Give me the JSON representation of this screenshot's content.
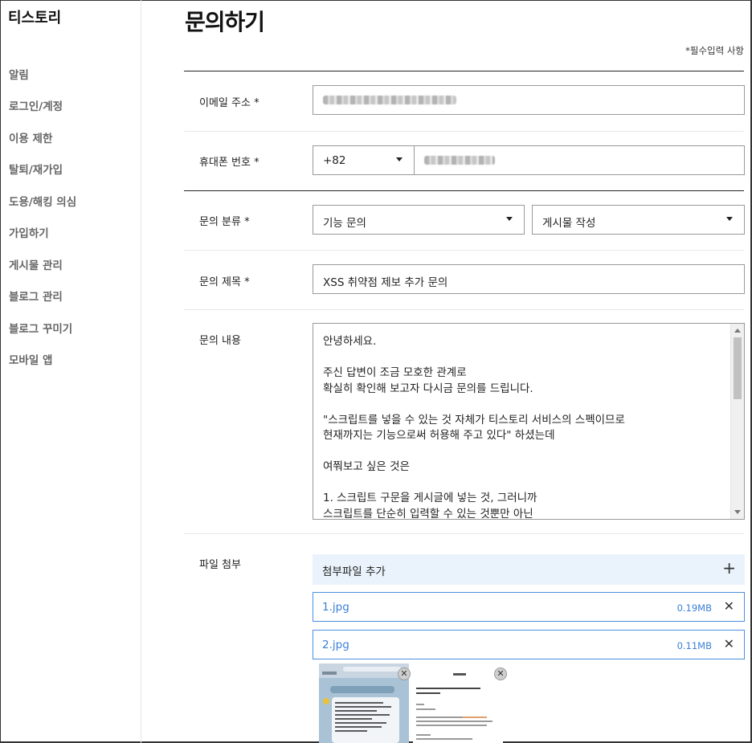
{
  "sidebar": {
    "brand": "티스토리",
    "items": [
      {
        "label": "알림"
      },
      {
        "label": "로그인/계정"
      },
      {
        "label": "이용 제한"
      },
      {
        "label": "탈퇴/재가입"
      },
      {
        "label": "도용/해킹 의심"
      },
      {
        "label": "가입하기"
      },
      {
        "label": "게시물 관리"
      },
      {
        "label": "블로그 관리"
      },
      {
        "label": "블로그 꾸미기"
      },
      {
        "label": "모바일 앱"
      }
    ]
  },
  "page": {
    "title": "문의하기",
    "required_note": "*필수입력 사항"
  },
  "form": {
    "email": {
      "label": "이메일 주소 *"
    },
    "phone": {
      "label": "휴대폰 번호 *",
      "country_code": "+82"
    },
    "category": {
      "label": "문의 분류 *",
      "primary": "기능 문의",
      "secondary": "게시물 작성"
    },
    "subject": {
      "label": "문의 제목 *",
      "value": "XSS 취약점 제보 추가 문의"
    },
    "content": {
      "label": "문의 내용",
      "lines": [
        "안녕하세요.",
        "",
        "주신 답변이 조금 모호한 관계로",
        "확실히 확인해 보고자 다시금 문의를 드립니다.",
        "",
        "\"스크립트를 넣을 수 있는 것 자체가 티스토리 서비스의 스펙이므로",
        "현재까지는 기능으로써 허용해 주고 있다\" 하셨는데",
        "",
        "여쭤보고 싶은 것은",
        "",
        "1. 스크립트 구문을 게시글에 넣는 것, 그러니까",
        "스크립트를 단순히 입력할 수 있는 것뿐만 아닌"
      ]
    },
    "attachment": {
      "label": "파일 첨부",
      "add_label": "첨부파일 추가",
      "add_icon": "plus-icon",
      "files": [
        {
          "name": "1.jpg",
          "size": "0.19MB"
        },
        {
          "name": "2.jpg",
          "size": "0.11MB"
        }
      ]
    }
  },
  "colors": {
    "accent": "#3a7fd6",
    "attach_bg": "#eaf3fb"
  }
}
